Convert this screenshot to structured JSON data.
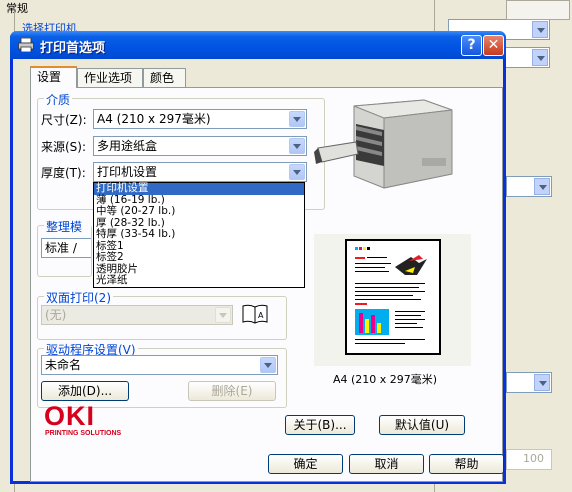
{
  "background_window": {
    "top_label": "常规",
    "second_label": "选择打印机",
    "spin_value": "100"
  },
  "dialog": {
    "title": "打印首选项",
    "help_button": "?",
    "close_button": "✕",
    "tabs": [
      {
        "label": "设置",
        "active": true
      },
      {
        "label": "作业选项",
        "active": false
      },
      {
        "label": "颜色",
        "active": false
      }
    ],
    "media": {
      "group_title": "介质",
      "size_label": "尺寸(Z):",
      "size_value": "A4 (210 x 297毫米)",
      "source_label": "来源(S):",
      "source_value": "多用途纸盒",
      "thickness_label": "厚度(T):",
      "thickness_value": "打印机设置",
      "thickness_options": [
        "打印机设置",
        "薄 (16-19 lb.)",
        "中等 (20-27 lb.)",
        "厚 (28-32 lb.)",
        "特厚 (33-54 lb.)",
        "标签1",
        "标签2",
        "透明胶片",
        "光泽纸"
      ],
      "thickness_selected_index": 0
    },
    "finishing": {
      "group_title": "整理模式",
      "value": "标准 /"
    },
    "duplex": {
      "group_title": "双面打印(2)",
      "value": "(无)"
    },
    "driver_settings": {
      "group_title": "驱动程序设置(V)",
      "value": "未命名",
      "add_button": "添加(D)...",
      "delete_button": "删除(E)"
    },
    "preview_caption": "A4 (210 x 297毫米)",
    "about_button": "关于(B)...",
    "default_button": "默认值(U)",
    "ok_button": "确定",
    "cancel_button": "取消",
    "help_footer_button": "帮助",
    "logo": {
      "brand": "OKI",
      "tagline": "PRINTING SOLUTIONS"
    },
    "colors": {
      "title_bar": "#0054e3",
      "selection": "#316ac5",
      "logo_red": "#d6001c",
      "group_title": "#0046d5"
    }
  }
}
